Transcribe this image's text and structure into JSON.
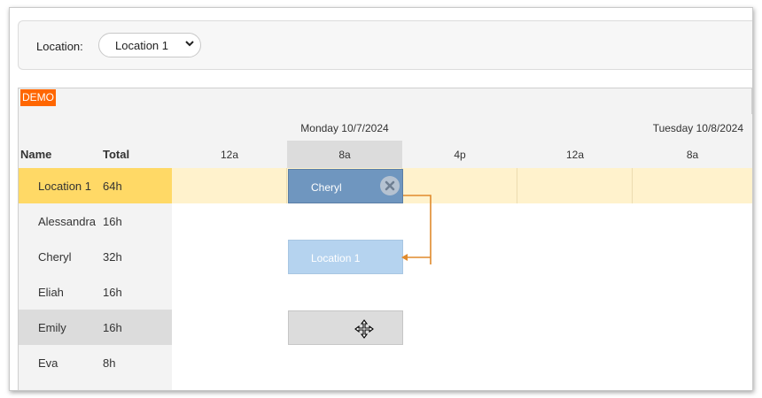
{
  "toolbar": {
    "location_label": "Location:",
    "location_value": "Location 1"
  },
  "scheduler": {
    "demo_badge": "DEMO",
    "columns": {
      "name": "Name",
      "total": "Total"
    },
    "days": [
      "Monday 10/7/2024",
      "Tuesday 10/8/2024"
    ],
    "times": [
      "12a",
      "8a",
      "4p",
      "12a",
      "8a"
    ],
    "rows": [
      {
        "name": "Location 1",
        "total": "64h"
      },
      {
        "name": "Alessandra",
        "total": "16h"
      },
      {
        "name": "Cheryl",
        "total": "32h"
      },
      {
        "name": "Eliah",
        "total": "16h"
      },
      {
        "name": "Emily",
        "total": "16h"
      },
      {
        "name": "Eva",
        "total": "8h"
      }
    ],
    "events": {
      "cheryl_shift": "Cheryl",
      "location_shift": "Location 1"
    }
  },
  "colors": {
    "highlight_row": "#fff2cc",
    "highlight_header": "#ffd966",
    "event_dark": "#6f96bf",
    "event_light": "#b5d3ef",
    "link": "#e08a2c",
    "demo": "#ff6600"
  }
}
